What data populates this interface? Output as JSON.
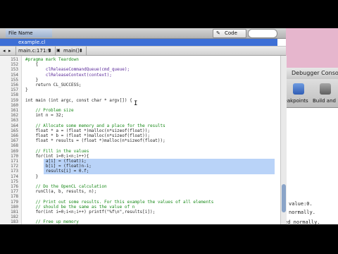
{
  "window": {
    "column_header": "File Name",
    "file_name": "example.cl",
    "code_button_label": "Code",
    "code_button_icon": "code-icon"
  },
  "navbar": {
    "location": "main.c:171:9",
    "function": "main()"
  },
  "debugger": {
    "title": "Debugger Console",
    "breakpoints_label": "Breakpoints",
    "build_label": "Build and",
    "output_line_1": "value:0.",
    "output_line_2": "normally.",
    "output_line_3": "ed normally."
  },
  "code_lines": [
    {
      "num": "151",
      "text": "#pragma mark Teardown",
      "style": "com"
    },
    {
      "num": "152",
      "text": "    {",
      "style": "def"
    },
    {
      "num": "153",
      "text": "        clReleaseCommandQueue(cmd_queue);",
      "style": "fn"
    },
    {
      "num": "154",
      "text": "        clReleaseContext(context);",
      "style": "fn"
    },
    {
      "num": "155",
      "text": "    }",
      "style": "def"
    },
    {
      "num": "156",
      "text": "    return CL_SUCCESS;",
      "style": "def"
    },
    {
      "num": "157",
      "text": "}",
      "style": "def"
    },
    {
      "num": "158",
      "text": "",
      "style": "def"
    },
    {
      "num": "159",
      "text": "int main (int argc, const char * argv[]) {",
      "style": "def"
    },
    {
      "num": "160",
      "text": "",
      "style": "def"
    },
    {
      "num": "161",
      "text": "    // Problem size",
      "style": "com"
    },
    {
      "num": "162",
      "text": "    int n = 32;",
      "style": "def"
    },
    {
      "num": "163",
      "text": "",
      "style": "def"
    },
    {
      "num": "164",
      "text": "    // Allocate some memory and a place for the results",
      "style": "com"
    },
    {
      "num": "165",
      "text": "    float * a = (float *)malloc(n*sizeof(float));",
      "style": "def"
    },
    {
      "num": "166",
      "text": "    float * b = (float *)malloc(n*sizeof(float));",
      "style": "def"
    },
    {
      "num": "167",
      "text": "    float * results = (float *)malloc(n*sizeof(float));",
      "style": "def"
    },
    {
      "num": "168",
      "text": "",
      "style": "def"
    },
    {
      "num": "169",
      "text": "    // Fill in the values",
      "style": "com"
    },
    {
      "num": "170",
      "text": "    for(int i=0;i<n;i++){",
      "style": "def"
    },
    {
      "num": "171",
      "text": "        a[i] = (float)i;",
      "style": "def"
    },
    {
      "num": "172",
      "text": "        b[i] = (float)n-i;",
      "style": "def"
    },
    {
      "num": "173",
      "text": "        results[i] = 0.f;",
      "style": "def"
    },
    {
      "num": "174",
      "text": "    }",
      "style": "def"
    },
    {
      "num": "175",
      "text": "",
      "style": "def"
    },
    {
      "num": "176",
      "text": "    // Do the OpenCL calculation",
      "style": "com"
    },
    {
      "num": "177",
      "text": "    runCl(a, b, results, n);",
      "style": "def"
    },
    {
      "num": "178",
      "text": "",
      "style": "def"
    },
    {
      "num": "179",
      "text": "    // Print out some results. For this example the values of all elements",
      "style": "com"
    },
    {
      "num": "180",
      "text": "    // should be the same as the value of n",
      "style": "com"
    },
    {
      "num": "181",
      "text": "    for(int i=0;i<n;i++) printf(\"%f\\n\",results[i]);",
      "style": "def"
    },
    {
      "num": "182",
      "text": "",
      "style": "def"
    },
    {
      "num": "183",
      "text": "    // Free up memory",
      "style": "com"
    }
  ],
  "selected_lines": [
    "171",
    "172",
    "173"
  ],
  "colors": {
    "selection": "#b9d3f8",
    "comment": "#1a8a1a",
    "accent": "#3d6fd6"
  }
}
